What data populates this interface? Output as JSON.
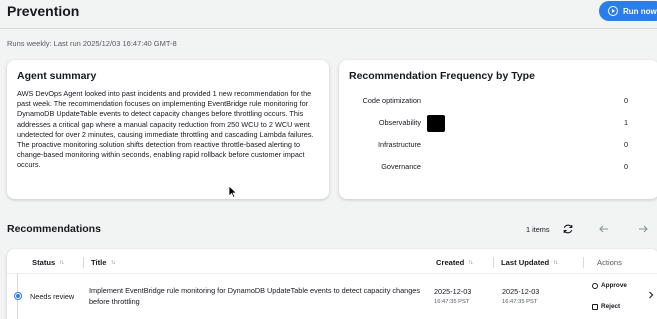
{
  "header": {
    "title": "Prevention",
    "run_button_label": "Run now"
  },
  "schedule_text": "Runs weekly: Last run 2025/12/03 16:47:40 GMT-8",
  "summary": {
    "title": "Agent summary",
    "text": "AWS DevOps Agent looked into past incidents and provided 1 new recommendation for the past week. The recommendation focuses on implementing EventBridge rule monitoring for DynamoDB UpdateTable events to detect capacity changes before throttling occurs. This addresses a critical gap where a manual capacity reduction from 250 WCU to 2 WCU went undetected for over 2 minutes, causing immediate throttling and cascading Lambda failures. The proactive monitoring solution shifts detection from reactive throttle-based alerting to change-based monitoring within seconds, enabling rapid rollback before customer impact occurs."
  },
  "frequency": {
    "title": "Recommendation Frequency by Type",
    "bar_color": "#000000"
  },
  "chart_data": {
    "type": "bar",
    "title": "Recommendation Frequency by Type",
    "categories": [
      "Code optimization",
      "Observability",
      "Infrastructure",
      "Governance"
    ],
    "values": [
      0,
      1,
      0,
      0
    ]
  },
  "recommendations": {
    "title": "Recommendations",
    "items_count": "1 items",
    "columns": {
      "status": "Status",
      "title": "Title",
      "created": "Created",
      "last_updated": "Last Updated",
      "actions": "Actions"
    },
    "rows": [
      {
        "status": "Needs review",
        "title": "Implement EventBridge rule monitoring for DynamoDB UpdateTable events to detect capacity changes before throttling",
        "created_date": "2025-12-03",
        "created_time": "16:47:35 PST",
        "updated_date": "2025-12-03",
        "updated_time": "16:47:35 PST",
        "approve_label": "Approve",
        "reject_label": "Reject"
      }
    ]
  },
  "colors": {
    "accent": "#2b7de9",
    "background": "#f2f3f3"
  }
}
